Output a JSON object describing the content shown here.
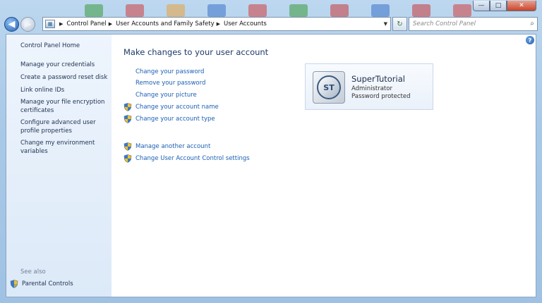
{
  "titlebar": {
    "min": "—",
    "max": "□",
    "close": "✕"
  },
  "nav": {
    "back_glyph": "◀",
    "forward_glyph": "▶",
    "breadcrumbs": [
      "Control Panel",
      "User Accounts and Family Safety",
      "User Accounts"
    ],
    "refresh_glyph": "↻",
    "search_placeholder": "Search Control Panel"
  },
  "sidebar": {
    "home": "Control Panel Home",
    "links": [
      "Manage your credentials",
      "Create a password reset disk",
      "Link online IDs",
      "Manage your file encryption certificates",
      "Configure advanced user profile properties",
      "Change my environment variables"
    ],
    "see_also": "See also",
    "parental": "Parental Controls"
  },
  "main": {
    "title": "Make changes to your user account",
    "tasks": [
      "Change your password",
      "Remove your password",
      "Change your picture"
    ],
    "admin_tasks": [
      "Change your account name",
      "Change your account type"
    ],
    "other_tasks": [
      "Manage another account",
      "Change User Account Control settings"
    ]
  },
  "user": {
    "name": "SuperTutorial",
    "role": "Administrator",
    "status": "Password protected",
    "avatar_text": "ST"
  },
  "help": "?",
  "colors": {
    "link": "#1a5fb4",
    "title": "#1c3a66",
    "sidebar_text": "#1e3050"
  }
}
